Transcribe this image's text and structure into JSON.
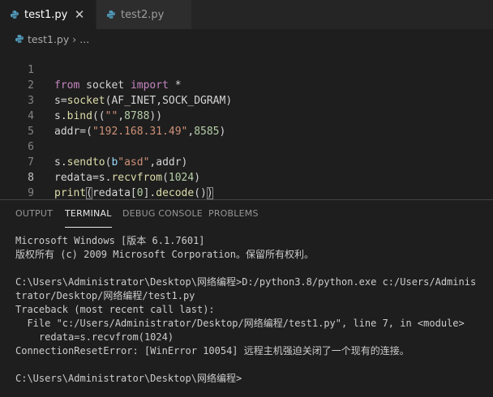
{
  "tabs": [
    {
      "label": "test1.py",
      "active": true
    },
    {
      "label": "test2.py",
      "active": false
    }
  ],
  "close_glyph": "✕",
  "breadcrumb": {
    "file": "test1.py",
    "sep": "›",
    "more": "..."
  },
  "editor": {
    "line_numbers": [
      "1",
      "2",
      "3",
      "4",
      "5",
      "6",
      "7",
      "8",
      "9"
    ],
    "lines": [
      [
        "from",
        " socket ",
        "import",
        " *"
      ],
      [
        "s=",
        "socket",
        "(AF_INET,SOCK_DGRAM)"
      ],
      [
        "s.",
        "bind",
        "((",
        "\"\"",
        ",",
        "8788",
        "))"
      ],
      [
        "addr=(",
        "\"192.168.31.49\"",
        ",",
        "8585",
        ")"
      ],
      [],
      [
        "s.",
        "sendto",
        "(",
        "b",
        "\"asd\"",
        ",addr)"
      ],
      [
        "redata=s.",
        "recvfrom",
        "(",
        "1024",
        ")"
      ],
      [
        "print",
        "(",
        "redata[",
        "0",
        "].",
        "decode",
        "()",
        ")"
      ],
      []
    ]
  },
  "panel_tabs": [
    "OUTPUT",
    "TERMINAL",
    "DEBUG CONSOLE",
    "PROBLEMS"
  ],
  "panel_active_tab": "TERMINAL",
  "terminal_lines": [
    "Microsoft Windows [版本 6.1.7601]",
    "版权所有 (c) 2009 Microsoft Corporation。保留所有权利。",
    "",
    "C:\\Users\\Administrator\\Desktop\\网络编程>D:/python3.8/python.exe c:/Users/Adminis",
    "trator/Desktop/网络编程/test1.py",
    "Traceback (most recent call last):",
    "  File \"c:/Users/Administrator/Desktop/网络编程/test1.py\", line 7, in <module>",
    "    redata=s.recvfrom(1024)",
    "ConnectionResetError: [WinError 10054] 远程主机强迫关闭了一个现有的连接。",
    "",
    "C:\\Users\\Administrator\\Desktop\\网络编程>"
  ],
  "colors": {
    "background": "#1e1e1e",
    "tabbar": "#252526",
    "python_icon": "#519aba",
    "keyword": "#c586c0",
    "function": "#dcdcaa",
    "string": "#ce9178",
    "number": "#b5cea8",
    "variable": "#9cdcfe"
  },
  "icons": {
    "file_icon": "python-file-icon",
    "close_icon": "close-icon"
  }
}
